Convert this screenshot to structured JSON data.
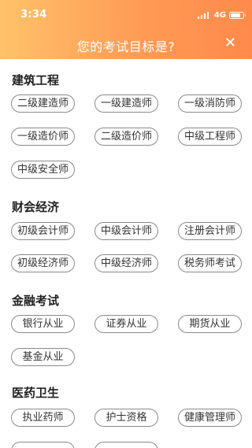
{
  "status": {
    "time": "3:34",
    "network": "4G",
    "signal_bars": 4,
    "battery_level": 0.8
  },
  "header": {
    "title": "您的考试目标是?",
    "close_icon": "close-icon",
    "gradient_colors": [
      "#ffc26a",
      "#ff8a4c"
    ]
  },
  "sections": [
    {
      "title": "建筑工程",
      "tags": [
        "二级建造师",
        "一级建造师",
        "一级消防师",
        "一级造价师",
        "二级造价师",
        "中级工程师",
        "中级安全师"
      ]
    },
    {
      "title": "财会经济",
      "tags": [
        "初级会计师",
        "中级会计师",
        "注册会计师",
        "初级经济师",
        "中级经济师",
        "税务师考试"
      ]
    },
    {
      "title": "金融考试",
      "tags": [
        "银行从业",
        "证券从业",
        "期货从业",
        "基金从业"
      ]
    },
    {
      "title": "医药卫生",
      "tags": [
        "执业药师",
        "护士资格",
        "健康管理师",
        "",
        ""
      ]
    }
  ]
}
